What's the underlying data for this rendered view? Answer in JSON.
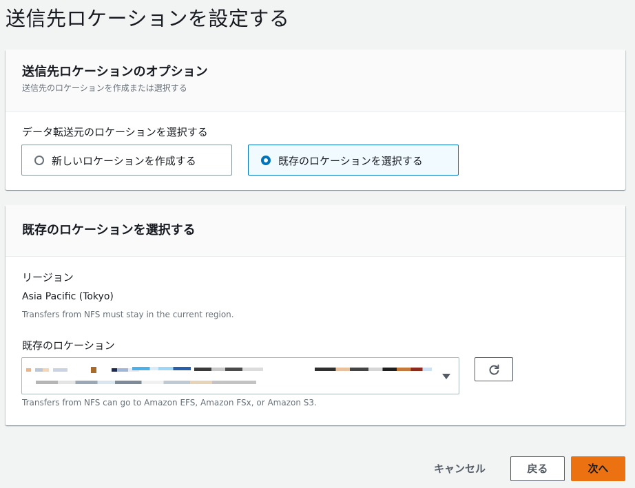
{
  "page": {
    "title": "送信先ロケーションを設定する"
  },
  "options_panel": {
    "title": "送信先ロケーションのオプション",
    "description": "送信先のロケーションを作成または選択する",
    "choice_label": "データ転送元のロケーションを選択する",
    "choices": [
      {
        "label": "新しいロケーションを作成する",
        "selected": false
      },
      {
        "label": "既存のロケーションを選択する",
        "selected": true
      }
    ]
  },
  "existing_panel": {
    "title": "既存のロケーションを選択する",
    "region_label": "リージョン",
    "region_value": "Asia Pacific (Tokyo)",
    "region_hint": "Transfers from NFS must stay in the current region.",
    "location_label": "既存のロケーション",
    "location_hint": "Transfers from NFS can go to Amazon EFS, Amazon FSx, or Amazon S3.",
    "location_value_redacted": true,
    "refresh_icon": "refresh-icon",
    "dropdown_icon": "caret-down-icon"
  },
  "footer": {
    "cancel_label": "キャンセル",
    "back_label": "戻る",
    "next_label": "次へ"
  },
  "colors": {
    "accent_blue": "#0073bb",
    "primary_orange": "#ec7211",
    "background": "#f2f3f3"
  }
}
